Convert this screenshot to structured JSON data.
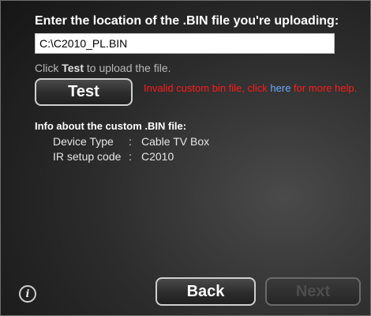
{
  "upload": {
    "heading": "Enter the location of the .BIN file you're uploading:",
    "path_value": "C:\\C2010_PL.BIN",
    "hint_prefix": "Click ",
    "hint_bold": "Test",
    "hint_suffix": " to upload the file."
  },
  "test_button": {
    "label": "Test"
  },
  "error": {
    "prefix": "Invalid custom bin file, click ",
    "link": "here",
    "suffix": " for more help."
  },
  "info": {
    "heading": "Info about the custom .BIN file:",
    "rows": [
      {
        "key": "Device Type",
        "separator": ":",
        "value": "Cable TV Box"
      },
      {
        "key": "IR setup code",
        "separator": ":",
        "value": "C2010"
      }
    ]
  },
  "nav": {
    "back_label": "Back",
    "next_label": "Next",
    "next_enabled": false
  },
  "icons": {
    "info": "info-icon"
  },
  "colors": {
    "error_text": "#ff1a1a",
    "link": "#6aa9ff",
    "disabled_text": "#4d4d4d"
  }
}
